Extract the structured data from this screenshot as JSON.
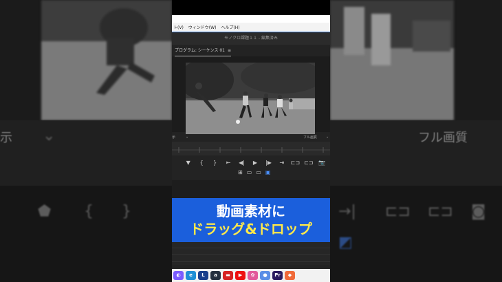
{
  "background": {
    "left_label": "示",
    "right_label": "フル画質",
    "icons": [
      "marker-icon",
      "in-point-icon",
      "out-point-icon",
      "go-to-out-icon",
      "lift-icon",
      "extract-icon",
      "camera-icon",
      "overwrite-icon"
    ]
  },
  "menu": {
    "items": [
      "ト(V)",
      "ウィンドウ(W)",
      "ヘルプ(H)"
    ]
  },
  "window": {
    "title": "モノクロ課題１１ - 編集済み"
  },
  "program_panel": {
    "tab_label": "プログラム: シーケンス 01",
    "menu_icon": "≡",
    "display_label": "示",
    "quality_label": "フル画質"
  },
  "transport": {
    "row1": [
      "▼",
      "{",
      "}",
      "⇤",
      "◀|",
      "▶",
      "|▶",
      "⇥",
      "⊏⊐",
      "⊏⊐",
      "📷"
    ],
    "row2": [
      "⊞",
      "▭",
      "▭",
      "▣"
    ]
  },
  "overlay": {
    "line1": "動画素材に",
    "line2": "ドラッグ&ドロップ"
  },
  "taskbar": {
    "icons": [
      {
        "name": "copilot-icon",
        "glyph": "◐",
        "color": "#7b5cff"
      },
      {
        "name": "edge-icon",
        "glyph": "e",
        "color": "#1f8fd6"
      },
      {
        "name": "l-app-icon",
        "glyph": "L",
        "color": "#1a3f8c"
      },
      {
        "name": "amazon-icon",
        "glyph": "a",
        "color": "#232f3e"
      },
      {
        "name": "red-app-icon",
        "glyph": "▬",
        "color": "#d62222"
      },
      {
        "name": "youtube-icon",
        "glyph": "▶",
        "color": "#e11"
      },
      {
        "name": "photos-icon",
        "glyph": "✿",
        "color": "#e25a9a"
      },
      {
        "name": "colorful-app-icon",
        "glyph": "●",
        "color": "#5a8ee6"
      },
      {
        "name": "premiere-icon",
        "glyph": "Pr",
        "color": "#2a1a5e"
      },
      {
        "name": "paint-icon",
        "glyph": "◆",
        "color": "#f06a3a"
      }
    ]
  }
}
